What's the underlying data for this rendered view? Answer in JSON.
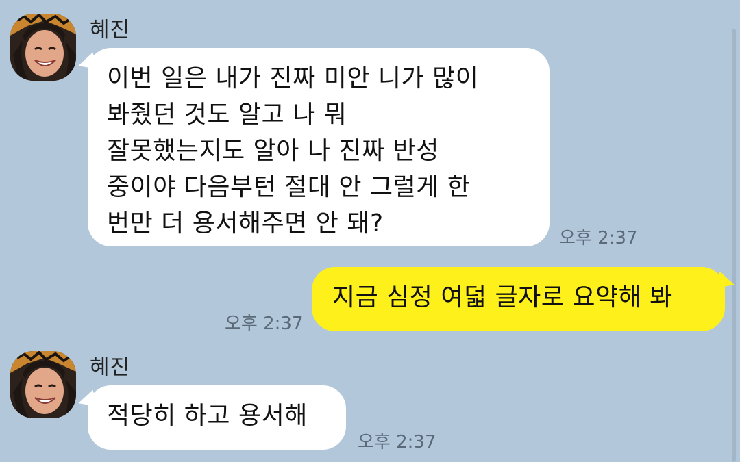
{
  "colors": {
    "background": "#b2c7da",
    "incoming_bubble": "#ffffff",
    "outgoing_bubble": "#fef01b",
    "time_text": "#5b6a78"
  },
  "messages": [
    {
      "sender": "혜진",
      "direction": "incoming",
      "lines": [
        "이번 일은 내가 진짜 미안 니가 많이",
        "봐줬던 것도 알고 나 뭐",
        "잘못했는지도 알아 나 진짜 반성",
        "중이야 다음부턴 절대 안 그럴게 한",
        "번만 더 용서해주면 안 돼?"
      ],
      "time": "오후 2:37"
    },
    {
      "direction": "outgoing",
      "lines": [
        "지금 심정 여덟 글자로 요약해 봐"
      ],
      "time": "오후 2:37"
    },
    {
      "sender": "혜진",
      "direction": "incoming",
      "lines": [
        "적당히 하고 용서해"
      ],
      "time": "오후 2:37"
    }
  ]
}
